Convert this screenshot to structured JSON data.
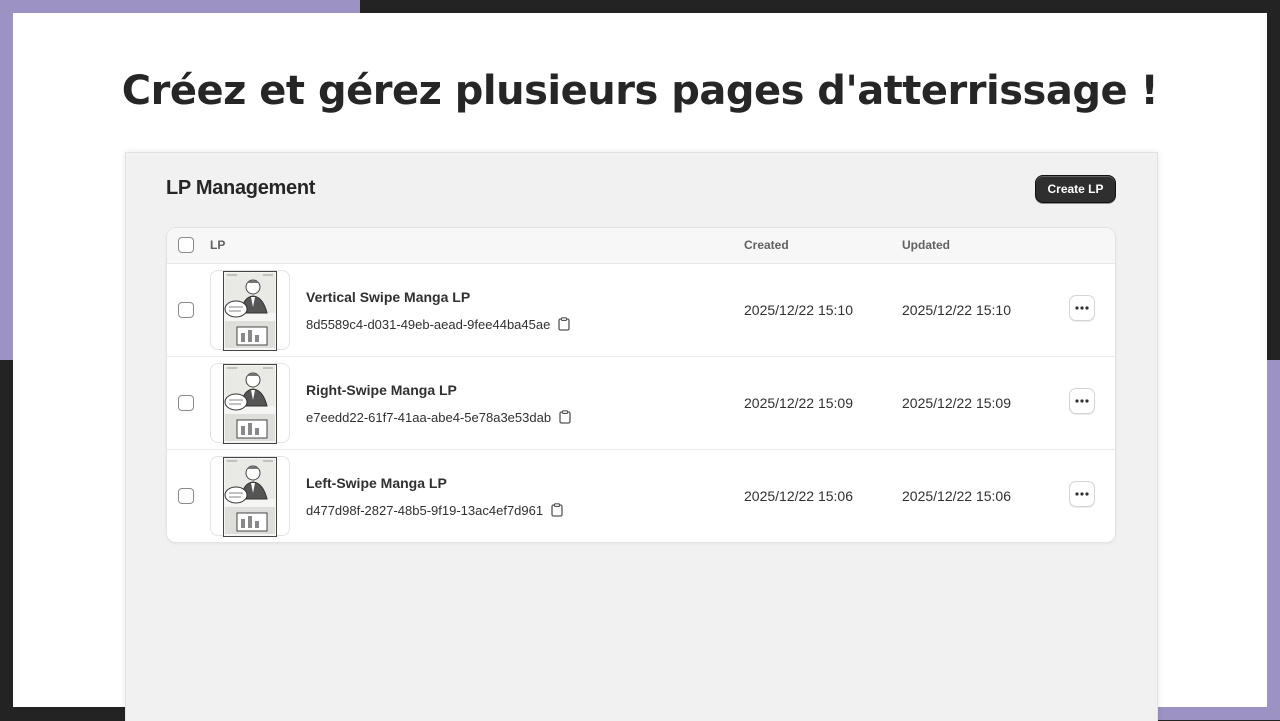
{
  "slide": {
    "headline": "Créez et gérez plusieurs pages d'atterrissage !"
  },
  "panel": {
    "title": "LP Management",
    "create_label": "Create LP"
  },
  "table": {
    "columns": {
      "lp": "LP",
      "created": "Created",
      "updated": "Updated"
    },
    "rows": [
      {
        "name": "Vertical Swipe Manga LP",
        "id": "8d5589c4-d031-49eb-aead-9fee44ba45ae",
        "created": "2025/12/22 15:10",
        "updated": "2025/12/22 15:10"
      },
      {
        "name": "Right-Swipe Manga LP",
        "id": "e7eedd22-61f7-41aa-abe4-5e78a3e53dab",
        "created": "2025/12/22 15:09",
        "updated": "2025/12/22 15:09"
      },
      {
        "name": "Left-Swipe Manga LP",
        "id": "d477d98f-2827-48b5-9f19-13ac4ef7d961",
        "created": "2025/12/22 15:06",
        "updated": "2025/12/22 15:06"
      }
    ]
  },
  "icons": {
    "copy": "clipboard-icon",
    "more": "ellipsis-icon",
    "thumbnail": "manga-thumbnail"
  },
  "colors": {
    "accent_purple": "#9d92c4",
    "dark": "#232323",
    "button": "#2f2f2f"
  }
}
